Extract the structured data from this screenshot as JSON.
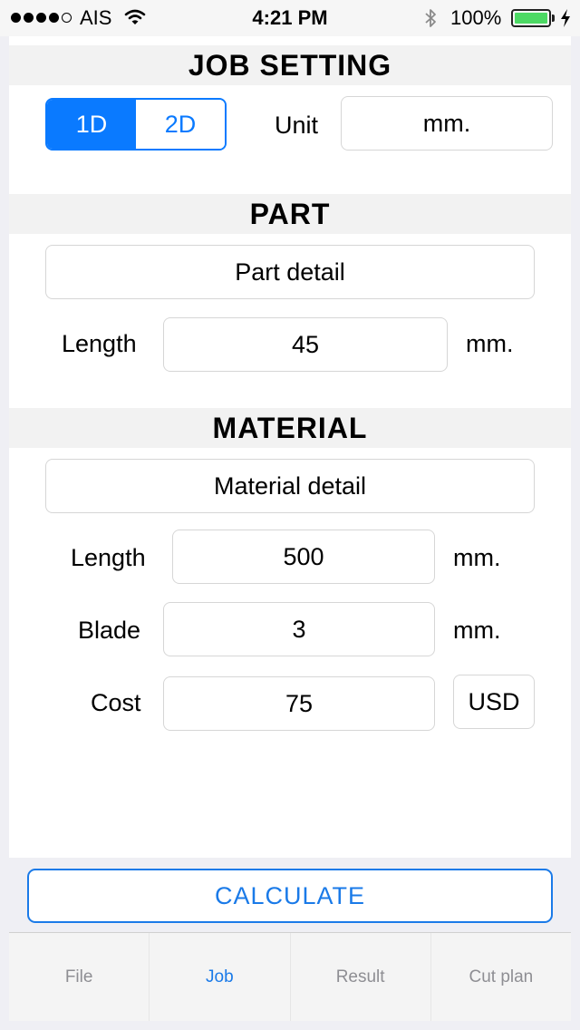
{
  "status_bar": {
    "carrier": "AIS",
    "time": "4:21 PM",
    "battery": "100%"
  },
  "job_setting": {
    "title": "JOB SETTING",
    "mode_options": [
      "1D",
      "2D"
    ],
    "selected_mode": "1D",
    "unit_label": "Unit",
    "unit_value": "mm."
  },
  "part": {
    "title": "PART",
    "detail_button": "Part detail",
    "length_label": "Length",
    "length_value": "45",
    "length_unit": "mm."
  },
  "material": {
    "title": "MATERIAL",
    "detail_button": "Material detail",
    "length_label": "Length",
    "length_value": "500",
    "length_unit": "mm.",
    "blade_label": "Blade",
    "blade_value": "3",
    "blade_unit": "mm.",
    "cost_label": "Cost",
    "cost_value": "75",
    "currency": "USD"
  },
  "calculate_label": "CALCULATE",
  "tabs": [
    {
      "label": "File"
    },
    {
      "label": "Job"
    },
    {
      "label": "Result"
    },
    {
      "label": "Cut plan"
    }
  ],
  "colors": {
    "accent": "#0a7aff",
    "battery": "#4cd964",
    "band": "#f2f2f2",
    "background": "#efeff4"
  }
}
